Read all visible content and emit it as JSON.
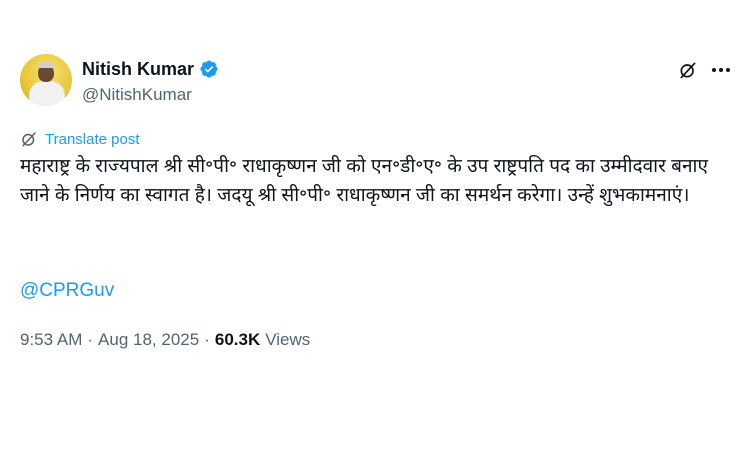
{
  "author": {
    "display_name": "Nitish Kumar",
    "handle": "@NitishKumar",
    "verified_color": "#1d9bf0"
  },
  "icons": {
    "verified": "verified-badge-icon",
    "grok": "grok-icon",
    "more": "more-options-icon",
    "translate": "translate-icon"
  },
  "translate_label": "Translate post",
  "post": {
    "text": "महाराष्ट्र के राज्यपाल श्री सी॰पी॰ राधाकृष्णन जी को एन॰डी॰ए॰ के उप राष्ट्रपति पद का उम्मीदवार बनाए जाने के निर्णय का स्वागत है। जदयू श्री सी॰पी॰ राधाकृष्णन जी का समर्थन करेगा। उन्हें शुभकामनाएं।",
    "mention": "@CPRGuv"
  },
  "meta": {
    "time": "9:53 AM",
    "date": "Aug 18, 2025",
    "views_count": "60.3K",
    "views_label": "Views",
    "separator": "·"
  },
  "colors": {
    "link": "#1d9bf0",
    "secondary_text": "#536471",
    "primary_text": "#0f1419"
  }
}
